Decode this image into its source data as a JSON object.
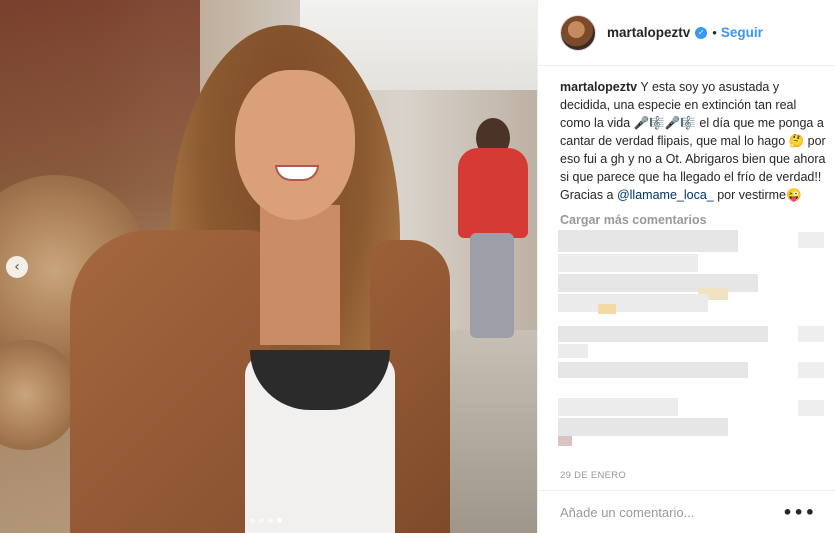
{
  "post": {
    "username": "martalopeztv",
    "verified_icon": "verified-badge-icon",
    "follow_label": "Seguir",
    "separator": "•"
  },
  "caption": {
    "username": "martalopeztv",
    "text_1": " Y esta soy yo asustada y decidida, una especie en extinción tan real como la vida 🎤🎼🎤🎼 el día que me ponga a cantar de verdad flipais, que mal lo hago 🤔 por eso fui a gh y no a Ot. Abrigaros bien que ahora si que parece que ha llegado el frío de verdad!! Gracias a ",
    "mention": "@llamame_loca_",
    "text_2": " por vestirme😜"
  },
  "load_more_label": "Cargar más comentarios",
  "date": "29 DE ENERO",
  "comment_input": {
    "placeholder": "Añade un comentario..."
  },
  "more_options_label": "•••",
  "carousel": {
    "prev_label": "‹",
    "count": 4,
    "active_index": 3
  },
  "colors": {
    "accent": "#3897f0",
    "text": "#262626",
    "muted": "#999999",
    "border": "#efefef"
  }
}
